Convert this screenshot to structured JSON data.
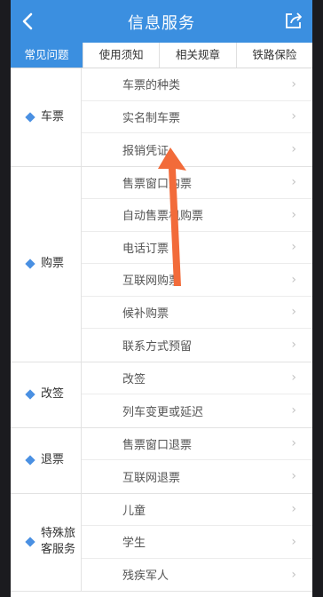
{
  "header": {
    "title": "信息服务"
  },
  "tabs": [
    "常见问题",
    "使用须知",
    "相关规章",
    "铁路保险"
  ],
  "groups": [
    {
      "label": "车票",
      "items": [
        "车票的种类",
        "实名制车票",
        "报销凭证"
      ]
    },
    {
      "label": "购票",
      "items": [
        "售票窗口购票",
        "自动售票机购票",
        "电话订票",
        "互联网购票",
        "候补购票",
        "联系方式预留"
      ]
    },
    {
      "label": "改签",
      "items": [
        "改签",
        "列车变更或延迟"
      ]
    },
    {
      "label": "退票",
      "items": [
        "售票窗口退票",
        "互联网退票"
      ]
    },
    {
      "label": "特殊旅客服务",
      "items": [
        "儿童",
        "学生",
        "残疾军人"
      ]
    }
  ],
  "colors": {
    "brand": "#3b8fe0",
    "annotation_arrow": "#f26b3a"
  }
}
